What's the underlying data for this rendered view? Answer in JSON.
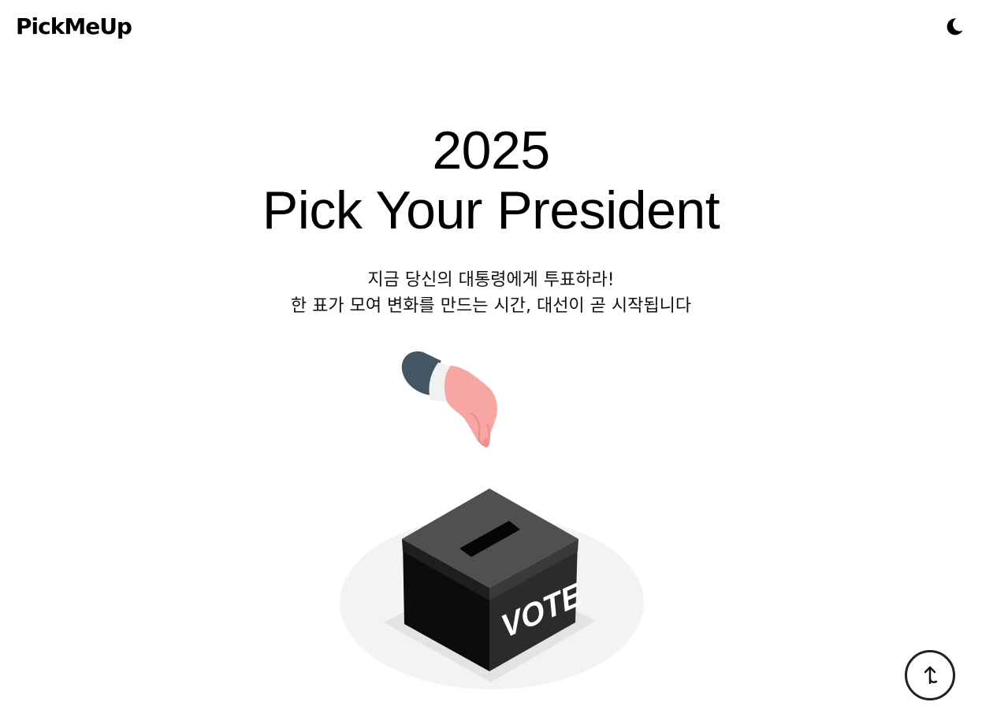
{
  "header": {
    "logo_text": "PickMeUp",
    "theme_toggle_icon": "moon-icon"
  },
  "hero": {
    "year": "2025",
    "title": "Pick Your President",
    "subtitle_line1": "지금 당신의 대통령에게 투표하라!",
    "subtitle_line2": "한 표가 모여 변화를 만드는 시간, 대선이 곧 시작됩니다"
  },
  "illustration": {
    "box_label": "VOTE",
    "icon": "ballot-box-illustration"
  },
  "scroll_top": {
    "icon": "arrow-up-icon"
  }
}
